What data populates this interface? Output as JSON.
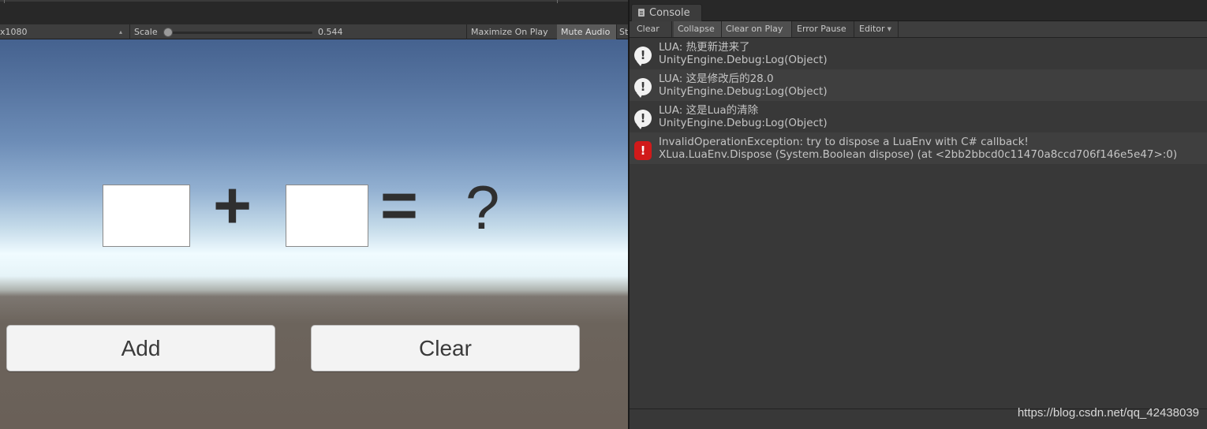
{
  "game_view": {
    "toolbar": {
      "resolution": "x1080",
      "scale_label": "Scale",
      "scale_value": "0.544",
      "scale_level": 0.0,
      "maximize_on_play": "Maximize On Play",
      "mute_audio": "Mute Audio",
      "stats": "St"
    },
    "calculator": {
      "plus": "+",
      "equals": "=",
      "result": "?",
      "add_label": "Add",
      "clear_label": "Clear"
    }
  },
  "console": {
    "tab_label": "Console",
    "toolbar": {
      "clear": "Clear",
      "collapse": "Collapse",
      "clear_on_play": "Clear on Play",
      "error_pause": "Error Pause",
      "editor": "Editor"
    },
    "logs": [
      {
        "type": "info",
        "line1": "LUA: 热更新进来了",
        "line2": "UnityEngine.Debug:Log(Object)"
      },
      {
        "type": "info",
        "line1": "LUA: 这是修改后的28.0",
        "line2": "UnityEngine.Debug:Log(Object)"
      },
      {
        "type": "info",
        "line1": "LUA: 这是Lua的清除",
        "line2": "UnityEngine.Debug:Log(Object)"
      },
      {
        "type": "error",
        "line1": "InvalidOperationException: try to dispose a LuaEnv with C# callback!",
        "line2": "XLua.LuaEnv.Dispose (System.Boolean dispose) (at <2bb2bbcd0c11470a8ccd706f146e5e47>:0)"
      }
    ]
  },
  "watermark": "https://blog.csdn.net/qq_42438039",
  "colors": {
    "error_icon": "#d11a1a",
    "info_icon": "#f2f2f2",
    "console_bg": "#383838"
  }
}
